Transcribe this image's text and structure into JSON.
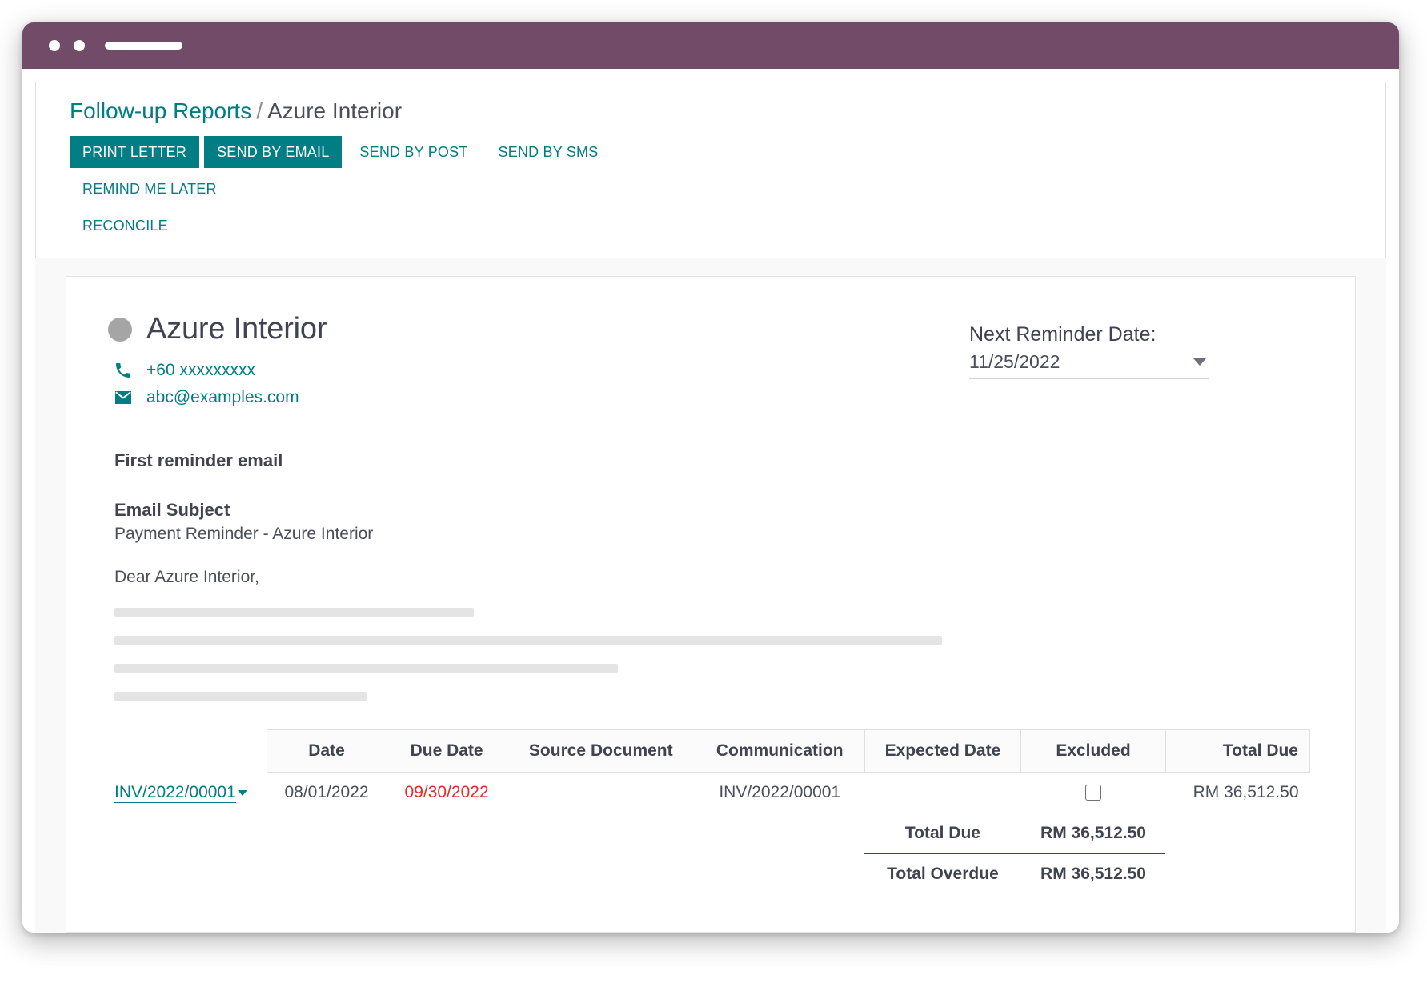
{
  "window": {
    "titlebar_color": "#714B67"
  },
  "breadcrumb": {
    "parent": "Follow-up Reports",
    "separator": "/",
    "current": "Azure Interior"
  },
  "actions": [
    {
      "label": "PRINT LETTER",
      "style": "primary"
    },
    {
      "label": "SEND BY EMAIL",
      "style": "primary"
    },
    {
      "label": "SEND BY POST",
      "style": "link"
    },
    {
      "label": "SEND BY SMS",
      "style": "link"
    },
    {
      "label": "REMIND ME LATER",
      "style": "link"
    },
    {
      "label": "RECONCILE",
      "style": "link"
    }
  ],
  "partner": {
    "name": "Azure Interior",
    "phone": "+60 xxxxxxxxx",
    "email": "abc@examples.com",
    "phone_icon": "phone-icon",
    "email_icon": "envelope-icon",
    "avatar_color": "#a5a5a5"
  },
  "reminder": {
    "label": "Next Reminder Date:",
    "date": "11/25/2022"
  },
  "email": {
    "stage": "First reminder email",
    "subject_label": "Email Subject",
    "subject_value": "Payment Reminder - Azure Interior",
    "salutation": "Dear Azure Interior,",
    "placeholder_bars": [
      {
        "width": "30%"
      },
      {
        "width": "69%"
      },
      {
        "width": "42%"
      },
      {
        "width": "21%"
      }
    ]
  },
  "table": {
    "columns": [
      "Date",
      "Due Date",
      "Source Document",
      "Communication",
      "Expected Date",
      "Excluded",
      "Total Due"
    ],
    "rows": [
      {
        "document": "INV/2022/00001",
        "date": "08/01/2022",
        "due_date": "09/30/2022",
        "due_overdue": true,
        "source_document": "",
        "communication": "INV/2022/00001",
        "expected_date": "",
        "excluded": false,
        "total_due": "RM 36,512.50"
      }
    ],
    "summary": [
      {
        "label": "Total Due",
        "value": "RM 36,512.50"
      },
      {
        "label": "Total Overdue",
        "value": "RM 36,512.50"
      }
    ]
  },
  "colors": {
    "accent": "#017e84",
    "brand": "#714B67",
    "overdue": "#e02c2c",
    "text": "#4a4f59"
  }
}
